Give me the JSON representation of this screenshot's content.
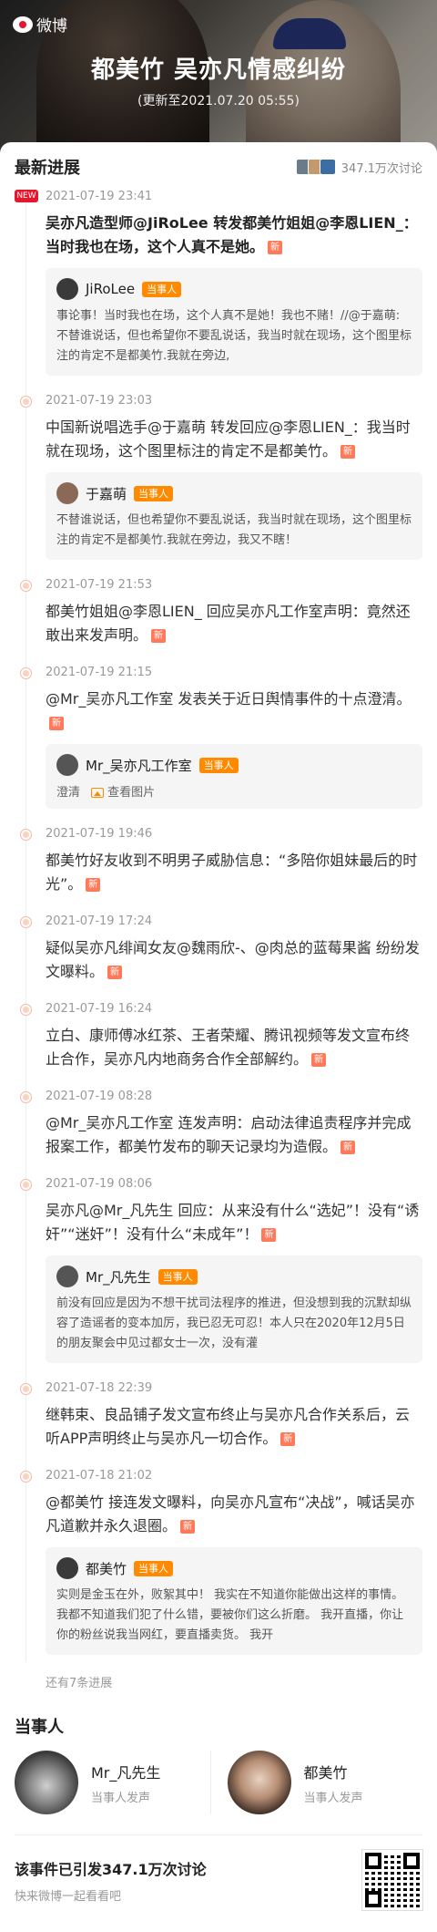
{
  "hero": {
    "brand": "微博",
    "title": "都美竹 吴亦凡情感纠纷",
    "updated": "(更新至2021.07.20 05:55)"
  },
  "progress": {
    "heading": "最新进展",
    "discuss_count": "347.1万次讨论"
  },
  "timeline": [
    {
      "time": "2021-07-19 23:41",
      "is_new_label": "NEW",
      "text": "吴亦凡造型师@JiRoLee 转发都美竹姐姐@李恩LIEN_：当时我也在场，这个人真不是她。",
      "quote": {
        "name": "JiRoLee",
        "tag": "当事人",
        "text": "事论事！当时我也在场，这个人真不是她！我也不赌！//@于嘉萌:不替谁说话，但也希望你不要乱说话，我当时就在现场，这个图里标注的肯定不是都美竹.我就在旁边,"
      }
    },
    {
      "time": "2021-07-19 23:03",
      "text": "中国新说唱选手@于嘉萌 转发回应@李恩LIEN_：我当时就在现场，这个图里标注的肯定不是都美竹。",
      "quote": {
        "name": "于嘉萌",
        "tag": "当事人",
        "text": "不替谁说话，但也希望你不要乱说话，我当时就在现场，这个图里标注的肯定不是都美竹.我就在旁边，我又不瞎！"
      }
    },
    {
      "time": "2021-07-19 21:53",
      "text": "都美竹姐姐@李恩LIEN_ 回应吴亦凡工作室声明：竟然还敢出来发声明。"
    },
    {
      "time": "2021-07-19 21:15",
      "text": "@Mr_吴亦凡工作室 发表关于近日舆情事件的十点澄清。",
      "quote": {
        "name": "Mr_吴亦凡工作室",
        "tag": "当事人",
        "links": [
          "澄清",
          "查看图片"
        ]
      }
    },
    {
      "time": "2021-07-19 19:46",
      "text": "都美竹好友收到不明男子威胁信息：“多陪你姐妹最后的时光”。"
    },
    {
      "time": "2021-07-19 17:24",
      "text": "疑似吴亦凡绯闻女友@魏雨欣-、@肉总的蓝莓果酱 纷纷发文曝料。"
    },
    {
      "time": "2021-07-19 16:24",
      "text": "立白、康师傅冰红茶、王者荣耀、腾讯视频等发文宣布终止合作，吴亦凡内地商务合作全部解约。"
    },
    {
      "time": "2021-07-19 08:28",
      "text": "@Mr_吴亦凡工作室 连发声明：启动法律追责程序并完成报案工作，都美竹发布的聊天记录均为造假。"
    },
    {
      "time": "2021-07-19 08:06",
      "text": "吴亦凡@Mr_凡先生 回应：从来没有什么“选妃”！没有“诱奸”“迷奸”！没有什么“未成年”！",
      "quote": {
        "name": "Mr_凡先生",
        "tag": "当事人",
        "text": "前没有回应是因为不想干扰司法程序的推进，但没想到我的沉默却纵容了造谣者的变本加厉，我已忍无可忍！本人只在2020年12月5日的朋友聚会中见过都女士一次，没有灌"
      }
    },
    {
      "time": "2021-07-18 22:39",
      "text": "继韩束、良品铺子发文宣布终止与吴亦凡合作关系后，云听APP声明终止与吴亦凡一切合作。"
    },
    {
      "time": "2021-07-18 21:02",
      "text": "@都美竹 接连发文曝料，向吴亦凡宣布“决战”，喊话吴亦凡道歉并永久退圈。",
      "quote": {
        "name": "都美竹",
        "tag": "当事人",
        "text": "实则是金玉在外，败絮其中！ 我实在不知道你能做出这样的事情。 我都不知道我们犯了什么错，要被你们这么折磨。 我开直播，你让你的粉丝说我当网红，要直播卖货。 我开"
      }
    }
  ],
  "new_badge": "新",
  "more": "还有7条进展",
  "participants": {
    "heading": "当事人",
    "items": [
      {
        "name": "Mr_凡先生",
        "desc": "当事人发声"
      },
      {
        "name": "都美竹",
        "desc": "当事人发声"
      }
    ]
  },
  "footer": {
    "line1": "该事件已引发347.1万次讨论",
    "line2": "快来微博一起看看吧"
  }
}
